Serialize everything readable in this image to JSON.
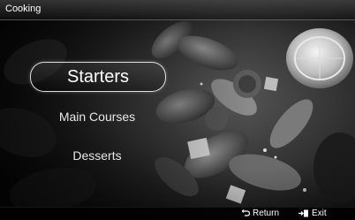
{
  "window": {
    "title": "Cooking"
  },
  "menu": {
    "items": [
      {
        "label": "Starters",
        "selected": true
      },
      {
        "label": "Main Courses",
        "selected": false
      },
      {
        "label": "Desserts",
        "selected": false
      }
    ]
  },
  "footer": {
    "return_label": "Return",
    "return_icon": "return-arrow-icon",
    "exit_label": "Exit",
    "exit_icon": "exit-door-icon"
  },
  "colors": {
    "background": "#000000",
    "text": "#ffffff"
  }
}
